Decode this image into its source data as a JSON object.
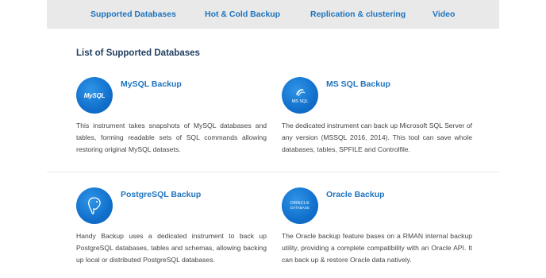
{
  "nav": {
    "items": [
      "Supported Databases",
      "Hot & Cold Backup",
      "Replication & clustering",
      "Video"
    ]
  },
  "section_title": "List of Supported Databases",
  "cards": [
    {
      "title": "MySQL Backup",
      "logo_text": "MySQL",
      "icon": "mysql-logo-icon",
      "description": "This instrument takes snapshots of MySQL databases and tables, forming readable sets of SQL commands allowing restoring original MySQL datasets."
    },
    {
      "title": "MS SQL Backup",
      "logo_text": "MS SQL",
      "icon": "mssql-logo-icon",
      "description": "The dedicated instrument can back up Microsoft SQL Server of any version (MSSQL 2016, 2014). This tool can save whole databases, tables, SPFILE and Controlfile."
    },
    {
      "title": "PostgreSQL Backup",
      "logo_text": "",
      "icon": "postgresql-logo-icon",
      "description": "Handy Backup uses a dedicated instrument to back up PostgreSQL databases, tables and schemas, allowing backing up local or distributed PostgreSQL databases."
    },
    {
      "title": "Oracle Backup",
      "logo_text": "ORACLE",
      "logo_subtext": "DATABASE",
      "icon": "oracle-logo-icon",
      "description": "The Oracle backup feature bases on a RMAN internal backup utility, providing a complete compatibility with an Oracle API. It can back up & restore Oracle data natively."
    }
  ],
  "colors": {
    "accent": "#1e73be",
    "heading": "#1d3c5e",
    "nav_bg": "#e9e9e9",
    "logo_blue": "#1170cc"
  }
}
